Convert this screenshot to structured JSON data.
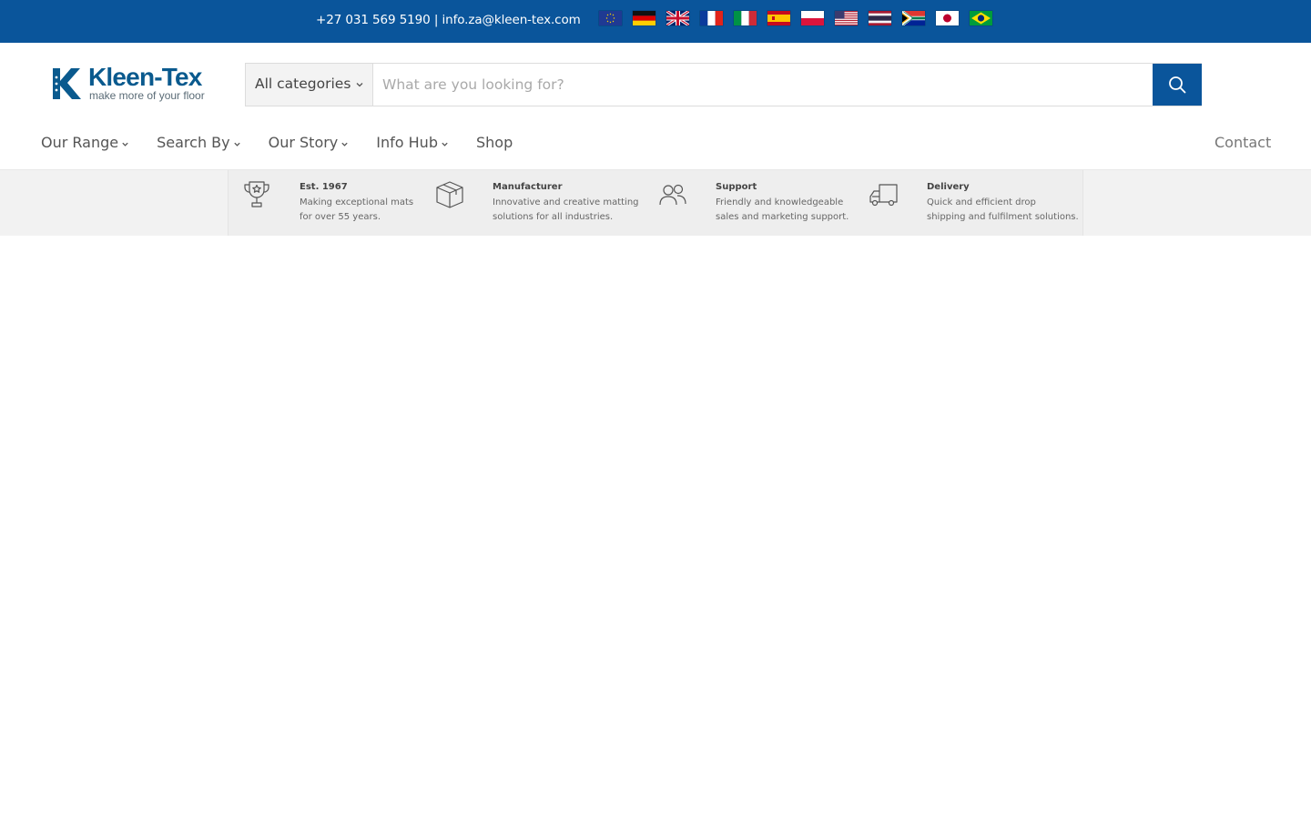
{
  "topbar": {
    "contact_text": "+27 031 569 5190 | info.za@kleen-tex.com",
    "flags": [
      "eu-flag-icon",
      "germany-flag-icon",
      "uk-flag-icon",
      "france-flag-icon",
      "italy-flag-icon",
      "spain-flag-icon",
      "poland-flag-icon",
      "usa-flag-icon",
      "thailand-flag-icon",
      "south-africa-flag-icon",
      "japan-flag-icon",
      "brazil-flag-icon"
    ],
    "background_color": "#0a559b"
  },
  "header": {
    "logo": {
      "name": "Kleen-Tex",
      "tagline": "make more of your floor",
      "color": "#0a5a8e"
    },
    "search": {
      "category_label": "All categories",
      "placeholder": "What are you looking for?",
      "button_icon": "search-icon"
    },
    "nav": {
      "items": [
        {
          "label": "Our Range",
          "has_dropdown": true
        },
        {
          "label": "Search By",
          "has_dropdown": true
        },
        {
          "label": "Our Story",
          "has_dropdown": true
        },
        {
          "label": "Info Hub",
          "has_dropdown": true
        },
        {
          "label": "Shop",
          "has_dropdown": false
        }
      ],
      "contact_label": "Contact"
    }
  },
  "features": [
    {
      "icon": "trophy-icon",
      "title": "Est. 1967",
      "line1": "Making exceptional mats",
      "line2": "for over 55 years."
    },
    {
      "icon": "box-icon",
      "title": "Manufacturer",
      "line1": "Innovative and creative matting",
      "line2": "solutions for all industries."
    },
    {
      "icon": "users-icon",
      "title": "Support",
      "line1": "Friendly and knowledgeable",
      "line2": "sales and marketing support."
    },
    {
      "icon": "truck-icon",
      "title": "Delivery",
      "line1": "Quick and efficient drop",
      "line2": "shipping and fulfilment solutions."
    }
  ]
}
